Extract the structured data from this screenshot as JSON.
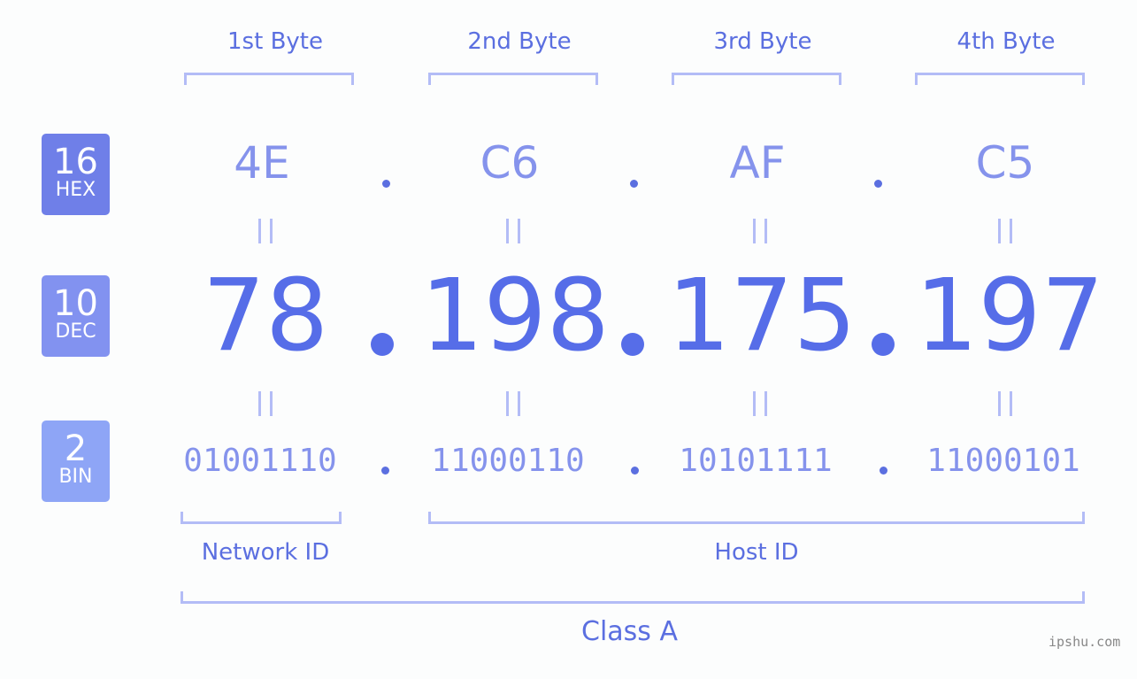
{
  "bytes": [
    {
      "label": "1st Byte",
      "hex": "4E",
      "dec": "78",
      "bin": "01001110"
    },
    {
      "label": "2nd Byte",
      "hex": "C6",
      "dec": "198",
      "bin": "11000110"
    },
    {
      "label": "3rd Byte",
      "hex": "AF",
      "dec": "175",
      "bin": "10101111"
    },
    {
      "label": "4th Byte",
      "hex": "C5",
      "dec": "197",
      "bin": "11000101"
    }
  ],
  "badges": {
    "hex": {
      "num": "16",
      "label": "HEX",
      "color": "#6f7fe8"
    },
    "dec": {
      "num": "10",
      "label": "DEC",
      "color": "#8292f0"
    },
    "bin": {
      "num": "2",
      "label": "BIN",
      "color": "#8ea5f6"
    }
  },
  "segments": {
    "network": "Network ID",
    "host": "Host ID",
    "class": "Class A"
  },
  "watermark": "ipshu.com"
}
